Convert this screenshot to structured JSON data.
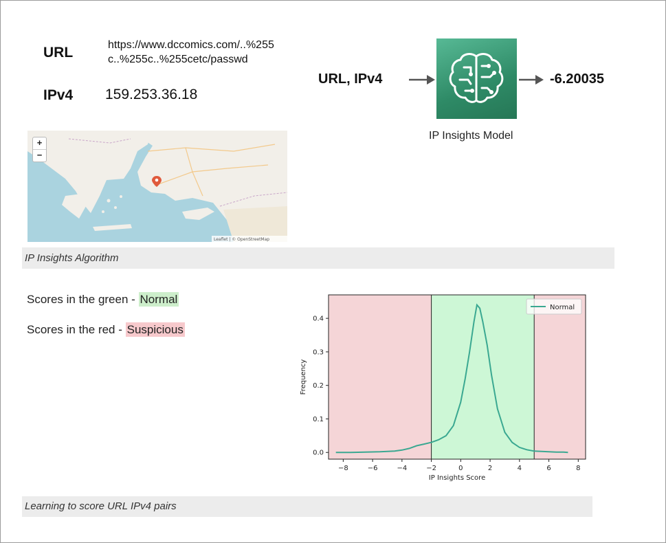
{
  "fields": {
    "url_label": "URL",
    "url_value": "https://www.dccomics.com/..%255c..%255c..%255cetc/passwd",
    "ip_label": "IPv4",
    "ip_value": "159.253.36.18"
  },
  "map": {
    "zoom_in": "+",
    "zoom_out": "−",
    "attribution": "Leaflet | © OpenStreetMap"
  },
  "model": {
    "input_label": "URL, IPv4",
    "output_value": "-6.20035",
    "caption": "IP Insights Model",
    "icon": "brain-circuit-icon",
    "color": "#2e8a66"
  },
  "caption_top": "IP Insights Algorithm",
  "legend": {
    "green_prefix": "Scores in the green - ",
    "green_word": "Normal",
    "red_prefix": "Scores in the red - ",
    "red_word": "Suspicious"
  },
  "caption_bottom": "Learning to score URL IPv4 pairs",
  "chart_data": {
    "type": "line",
    "xlabel": "IP Insights Score",
    "ylabel": "Frequency",
    "xlim": [
      -9,
      8.5
    ],
    "ylim": [
      -0.02,
      0.47
    ],
    "xticks": [
      -8,
      -6,
      -4,
      -2,
      0,
      2,
      4,
      6,
      8
    ],
    "yticks": [
      0.0,
      0.1,
      0.2,
      0.3,
      0.4
    ],
    "regions": [
      {
        "from": -9,
        "to": -2,
        "label": "Suspicious",
        "color": "#f5d5d7"
      },
      {
        "from": -2,
        "to": 5,
        "label": "Normal",
        "color": "#cdf7d6"
      },
      {
        "from": 5,
        "to": 8.5,
        "label": "Suspicious",
        "color": "#f5d5d7"
      }
    ],
    "legend_position": "upper-right",
    "series": [
      {
        "name": "Normal",
        "color": "#3aa891",
        "x": [
          -8.5,
          -7.5,
          -6.5,
          -5.5,
          -5.0,
          -4.5,
          -4.0,
          -3.5,
          -3.0,
          -2.5,
          -2.0,
          -1.5,
          -1.0,
          -0.5,
          0.0,
          0.3,
          0.6,
          0.9,
          1.1,
          1.3,
          1.5,
          1.8,
          2.1,
          2.5,
          3.0,
          3.5,
          4.0,
          4.5,
          5.0,
          5.5,
          6.0,
          6.5,
          7.0,
          7.3
        ],
        "y": [
          0.0,
          0.0,
          0.001,
          0.002,
          0.003,
          0.004,
          0.007,
          0.012,
          0.02,
          0.025,
          0.03,
          0.038,
          0.05,
          0.08,
          0.15,
          0.22,
          0.3,
          0.39,
          0.44,
          0.43,
          0.39,
          0.32,
          0.23,
          0.13,
          0.06,
          0.03,
          0.015,
          0.008,
          0.004,
          0.003,
          0.002,
          0.001,
          0.001,
          0.0
        ]
      }
    ]
  }
}
